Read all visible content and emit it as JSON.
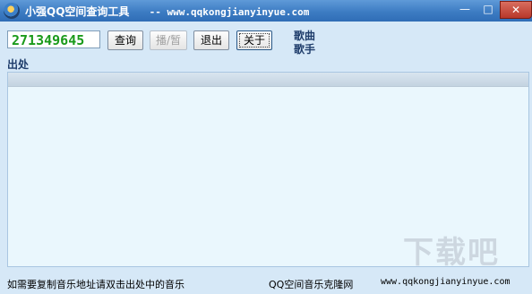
{
  "window": {
    "title": "小强QQ空间查询工具",
    "title_url": "-- www.qqkongjianyinyue.com",
    "controls": {
      "minimize": "—",
      "maximize": "□",
      "close": "✕"
    }
  },
  "toolbar": {
    "qq_value": "271349645",
    "query_label": "查询",
    "play_pause_label": "播/暂",
    "exit_label": "退出",
    "about_label": "关于"
  },
  "info": {
    "song_label": "歌曲",
    "singer_label": "歌手"
  },
  "source": {
    "label": "出处"
  },
  "status": {
    "left": "如需要复制音乐地址请双击出处中的音乐",
    "middle": "QQ空间音乐克隆网",
    "right": "www.qqkongjianyinyue.com"
  },
  "watermark": {
    "text": "下载吧"
  }
}
